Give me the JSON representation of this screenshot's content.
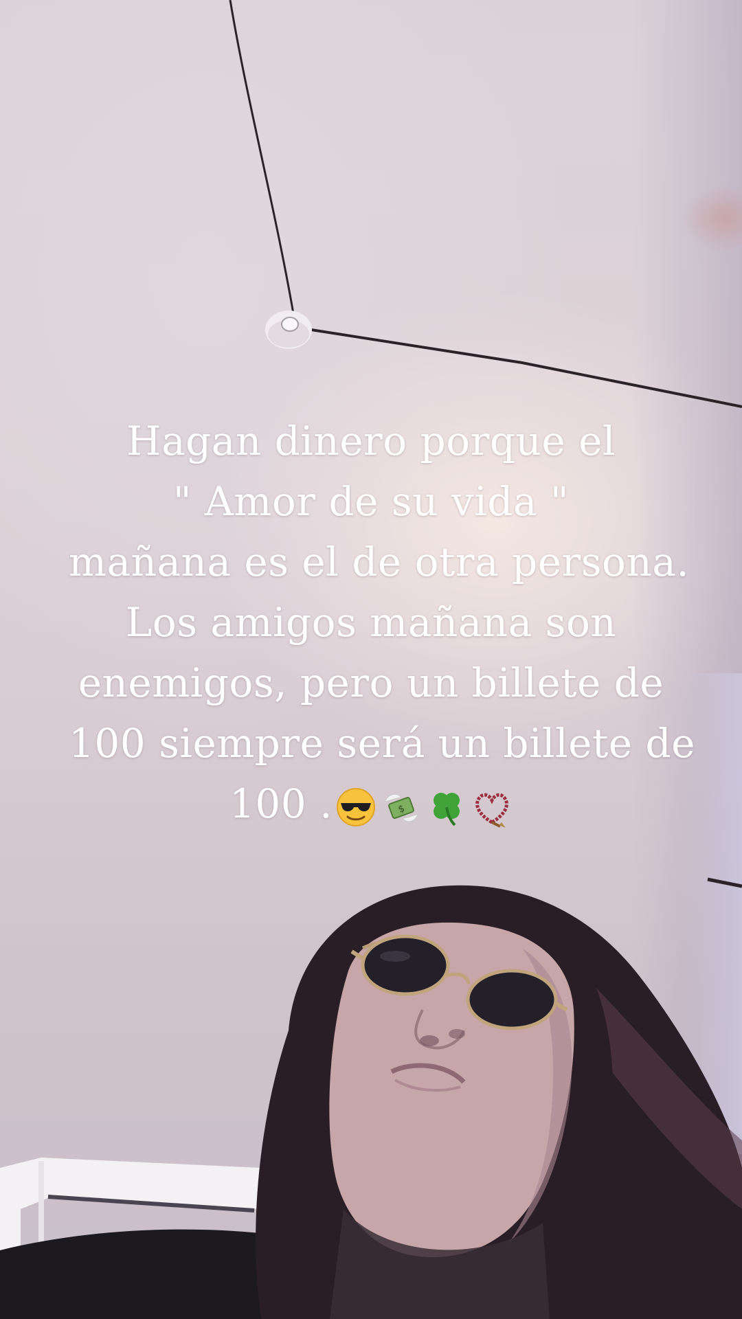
{
  "story": {
    "caption_lines": [
      "Hagan dinero  porque el",
      "\" Amor de su vida \"",
      "mañana es el de otra persona.",
      "Los amigos mañana son",
      "enemigos, pero un billete de",
      "100 siempre será un billete de",
      "100 ."
    ],
    "caption_emojis": [
      "sunglasses-face-icon",
      "money-with-wings-icon",
      "four-leaf-clover-icon",
      "prayer-beads-icon"
    ],
    "colors": {
      "caption_text": "#ffffff",
      "ceiling": "#d9d2d8",
      "hair": "#2a1e26",
      "skin": "#c7a7a8",
      "shirt": "#1c1a1e"
    }
  }
}
